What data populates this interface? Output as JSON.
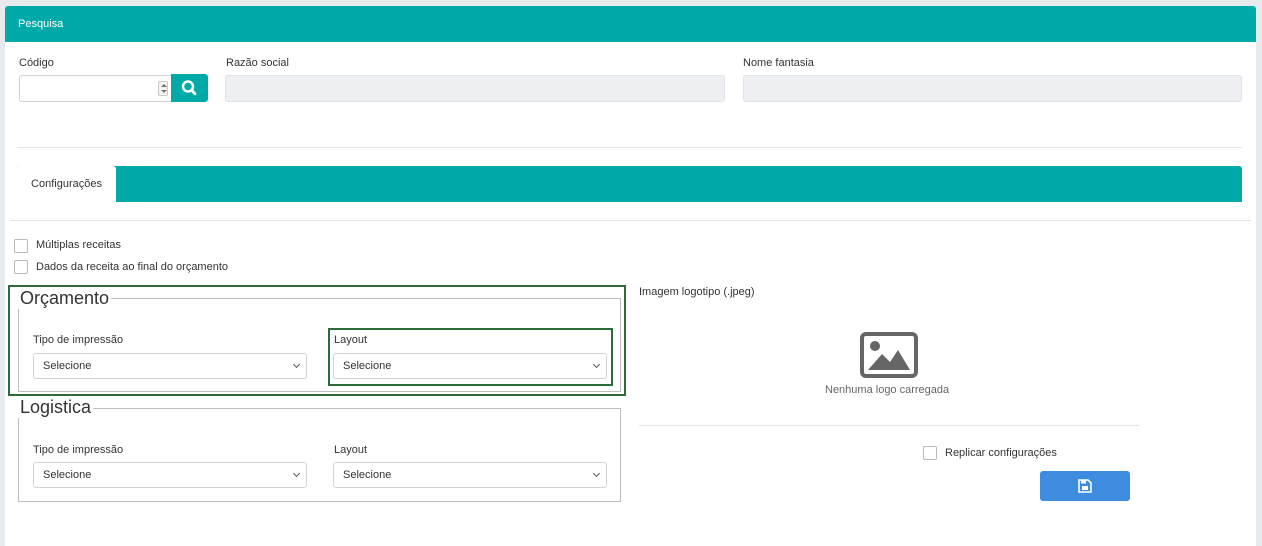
{
  "header": {
    "title": "Pesquisa"
  },
  "search": {
    "codigo_label": "Código",
    "codigo_value": "",
    "razao_label": "Razão social",
    "razao_value": "",
    "fantasia_label": "Nome fantasia",
    "fantasia_value": ""
  },
  "tabs": {
    "active_label": "Configurações"
  },
  "options": {
    "multiplas_label": "Múltiplas receitas",
    "dados_label": "Dados da receita ao final do orçamento"
  },
  "orcamento": {
    "legend": "Orçamento",
    "tipo_label": "Tipo de impressão",
    "tipo_value": "Selecione",
    "layout_label": "Layout",
    "layout_value": "Selecione"
  },
  "logistica": {
    "legend": "Logistica",
    "tipo_label": "Tipo de impressão",
    "tipo_value": "Selecione",
    "layout_label": "Layout",
    "layout_value": "Selecione"
  },
  "logo": {
    "label": "Imagem logotipo (.jpeg)",
    "empty_text": "Nenhuma logo carregada",
    "icon": "image-placeholder-icon"
  },
  "replicar": {
    "label": "Replicar configurações"
  },
  "icons": {
    "search": "search-icon",
    "save": "floppy-disk-icon"
  },
  "colors": {
    "accent": "#00aaa8",
    "save_button": "#3d8ce0",
    "highlight": "#2e6b3a"
  }
}
